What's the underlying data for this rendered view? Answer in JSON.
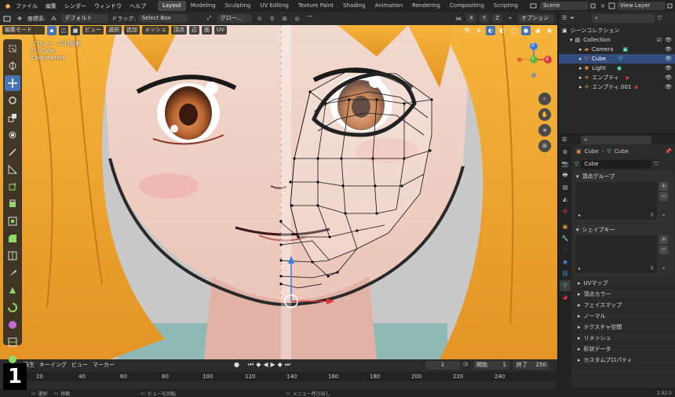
{
  "menu": [
    "ファイル",
    "編集",
    "レンダー",
    "ウィンドウ",
    "ヘルプ"
  ],
  "workspaces": [
    "Layout",
    "Modeling",
    "Sculpting",
    "UV Editing",
    "Texture Paint",
    "Shading",
    "Animation",
    "Rendering",
    "Compositing",
    "Scripting"
  ],
  "scene": "Scene",
  "view_layer": "View Layer",
  "header": {
    "coord_label": "座標系:",
    "coord_value": "デフォルト",
    "drag_label": "ドラッグ:",
    "drag_value": "Select Box",
    "transform": "グロー...",
    "axes": [
      "X",
      "Y",
      "Z"
    ],
    "options": "オプション"
  },
  "header2": {
    "mode": "編集モード",
    "menus": [
      "ビュー",
      "選択",
      "追加",
      "メッシュ",
      "頂点",
      "辺",
      "面",
      "UV"
    ]
  },
  "viewport_info": {
    "line1": "フロント・平行投影",
    "line2": "(1) Cube",
    "line3": "Centimeters"
  },
  "gizmo": {
    "x": "X",
    "y": "Y",
    "z": "Z"
  },
  "outliner": {
    "title": "シーンコレクション",
    "collection": "Collection",
    "items": [
      "Camera",
      "Cube",
      "Light",
      "エンプティ",
      "エンプティ.001"
    ]
  },
  "props": {
    "object": "Cube",
    "mesh": "Cube",
    "mesh_field": "Cube",
    "vertex_groups": "頂点グループ",
    "shape_keys": "シェイプキー",
    "closed": [
      "UVマップ",
      "頂点カラー",
      "フェイスマップ",
      "ノーマル",
      "テクスチャ空間",
      "リメッシュ",
      "形状データ",
      "カスタムプロパティ"
    ]
  },
  "timeline": {
    "menus": [
      "再生",
      "キーイング",
      "ビュー",
      "マーカー"
    ],
    "current": "1",
    "start_label": "開始",
    "start": "1",
    "end_label": "終了",
    "end": "250",
    "ticks": [
      "0",
      "20",
      "40",
      "60",
      "80",
      "100",
      "120",
      "140",
      "160",
      "180",
      "200",
      "220",
      "240"
    ]
  },
  "status": {
    "select": "選択",
    "move": "移動",
    "rotate": "ビューを回転",
    "call_menu": "メニュー呼び出し",
    "version": "2.92.0"
  },
  "badge": "1",
  "colors": {
    "accent": "#4772b3",
    "selected_row": "#334d80",
    "x_axis": "#d9363f",
    "y_axis": "#63b33b",
    "z_axis": "#3f7ee0"
  }
}
